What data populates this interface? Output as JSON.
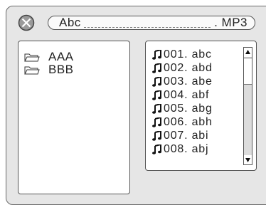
{
  "header": {
    "close_icon": "close-circle-x-icon",
    "filename": "Abc",
    "extension": ". MP3"
  },
  "folders": [
    {
      "label": "AAA",
      "icon": "folder-icon"
    },
    {
      "label": "BBB",
      "icon": "folder-icon"
    }
  ],
  "files": [
    {
      "label": "001. abc",
      "icon": "music-note-icon"
    },
    {
      "label": "002. abd",
      "icon": "music-note-icon"
    },
    {
      "label": "003. abe",
      "icon": "music-note-icon"
    },
    {
      "label": "004. abf",
      "icon": "music-note-icon"
    },
    {
      "label": "005. abg",
      "icon": "music-note-icon"
    },
    {
      "label": "006. abh",
      "icon": "music-note-icon"
    },
    {
      "label": "007. abi",
      "icon": "music-note-icon"
    },
    {
      "label": "008. abj",
      "icon": "music-note-icon"
    }
  ],
  "scrollbar": {
    "up_icon": "scroll-up-arrow-icon",
    "down_icon": "scroll-down-arrow-icon"
  }
}
